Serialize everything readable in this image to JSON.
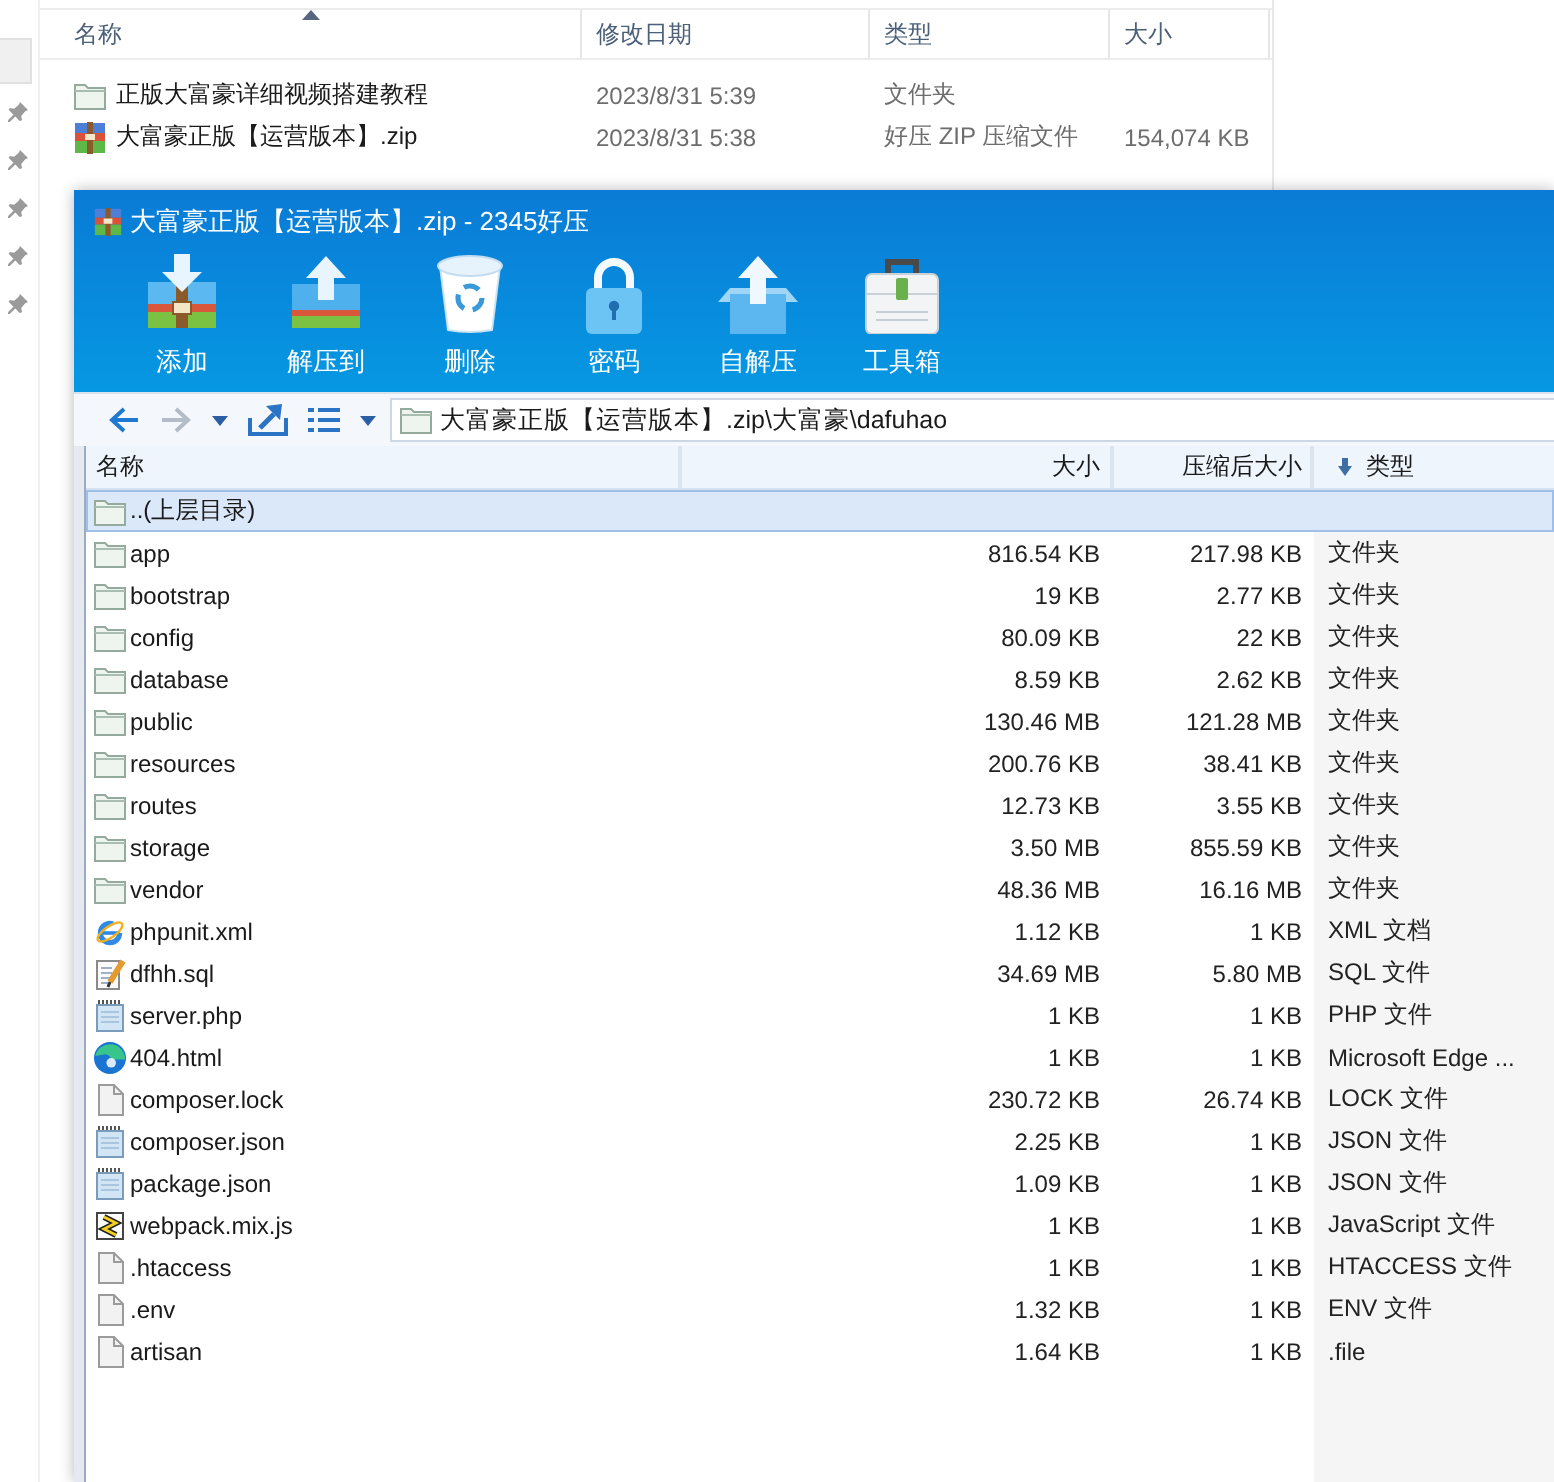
{
  "explorer": {
    "columns": [
      {
        "label": "名称",
        "sorted": true
      },
      {
        "label": "修改日期",
        "sorted": false
      },
      {
        "label": "类型",
        "sorted": false
      },
      {
        "label": "大小",
        "sorted": false
      }
    ],
    "rows": [
      {
        "kind": "folder",
        "name": "正版大富豪详细视频搭建教程",
        "modified": "2023/8/31 5:39",
        "type": "文件夹",
        "selected": false
      },
      {
        "kind": "archive",
        "name": "大富豪正版【运营版本】.zip",
        "modified": "2023/8/31 5:38",
        "type": "好压 ZIP 压缩文件",
        "size": "154,074 KB",
        "selected": false
      }
    ]
  },
  "window": {
    "title": "大富豪正版【运营版本】.zip - 2345好压"
  },
  "toolbar": [
    {
      "kind": "add",
      "label": "添加"
    },
    {
      "kind": "extract",
      "label": "解压到"
    },
    {
      "kind": "delete",
      "label": "删除"
    },
    {
      "kind": "password",
      "label": "密码"
    },
    {
      "kind": "sfx",
      "label": "自解压"
    },
    {
      "kind": "toolbox",
      "label": "工具箱"
    }
  ],
  "navigation": {
    "back_disabled": false,
    "forward_disabled": true
  },
  "address": {
    "path": "大富豪正版【运营版本】.zip\\大富豪\\dafuhao"
  },
  "table": {
    "columns": [
      {
        "label": "名称",
        "sorted": false
      },
      {
        "label": "大小",
        "sorted": false
      },
      {
        "label": "压缩后大小",
        "sorted": false
      },
      {
        "label": "类型",
        "sorted": true
      }
    ],
    "rows": [
      {
        "kind": "parent",
        "name": "..(上层目录)",
        "selected": true
      },
      {
        "kind": "folder",
        "name": "app",
        "size": "816.54 KB",
        "packed_size": "217.98 KB",
        "type": "文件夹",
        "selected": false
      },
      {
        "kind": "folder",
        "name": "bootstrap",
        "size": "19 KB",
        "packed_size": "2.77 KB",
        "type": "文件夹",
        "selected": false
      },
      {
        "kind": "folder",
        "name": "config",
        "size": "80.09 KB",
        "packed_size": "22 KB",
        "type": "文件夹",
        "selected": false
      },
      {
        "kind": "folder",
        "name": "database",
        "size": "8.59 KB",
        "packed_size": "2.62 KB",
        "type": "文件夹",
        "selected": false
      },
      {
        "kind": "folder",
        "name": "public",
        "size": "130.46 MB",
        "packed_size": "121.28 MB",
        "type": "文件夹",
        "selected": false
      },
      {
        "kind": "folder",
        "name": "resources",
        "size": "200.76 KB",
        "packed_size": "38.41 KB",
        "type": "文件夹",
        "selected": false
      },
      {
        "kind": "folder",
        "name": "routes",
        "size": "12.73 KB",
        "packed_size": "3.55 KB",
        "type": "文件夹",
        "selected": false
      },
      {
        "kind": "folder",
        "name": "storage",
        "size": "3.50 MB",
        "packed_size": "855.59 KB",
        "type": "文件夹",
        "selected": false
      },
      {
        "kind": "folder",
        "name": "vendor",
        "size": "48.36 MB",
        "packed_size": "16.16 MB",
        "type": "文件夹",
        "selected": false
      },
      {
        "kind": "xml",
        "name": "phpunit.xml",
        "size": "1.12 KB",
        "packed_size": "1 KB",
        "type": "XML 文档",
        "selected": false
      },
      {
        "kind": "sql",
        "name": "dfhh.sql",
        "size": "34.69 MB",
        "packed_size": "5.80 MB",
        "type": "SQL 文件",
        "selected": false
      },
      {
        "kind": "php",
        "name": "server.php",
        "size": "1 KB",
        "packed_size": "1 KB",
        "type": "PHP 文件",
        "selected": false
      },
      {
        "kind": "html",
        "name": "404.html",
        "size": "1 KB",
        "packed_size": "1 KB",
        "type": "Microsoft Edge ...",
        "selected": false
      },
      {
        "kind": "file",
        "name": "composer.lock",
        "size": "230.72 KB",
        "packed_size": "26.74 KB",
        "type": "LOCK 文件",
        "selected": false
      },
      {
        "kind": "json",
        "name": "composer.json",
        "size": "2.25 KB",
        "packed_size": "1 KB",
        "type": "JSON 文件",
        "selected": false
      },
      {
        "kind": "json",
        "name": "package.json",
        "size": "1.09 KB",
        "packed_size": "1 KB",
        "type": "JSON 文件",
        "selected": false
      },
      {
        "kind": "script",
        "name": "webpack.mix.js",
        "size": "1 KB",
        "packed_size": "1 KB",
        "type": "JavaScript 文件",
        "selected": false
      },
      {
        "kind": "file",
        "name": ".htaccess",
        "size": "1 KB",
        "packed_size": "1 KB",
        "type": "HTACCESS 文件",
        "selected": false
      },
      {
        "kind": "file",
        "name": ".env",
        "size": "1.32 KB",
        "packed_size": "1 KB",
        "type": "ENV 文件",
        "selected": false
      },
      {
        "kind": "file",
        "name": "artisan",
        "size": "1.64 KB",
        "packed_size": "1 KB",
        "type": ".file",
        "selected": false
      }
    ]
  }
}
